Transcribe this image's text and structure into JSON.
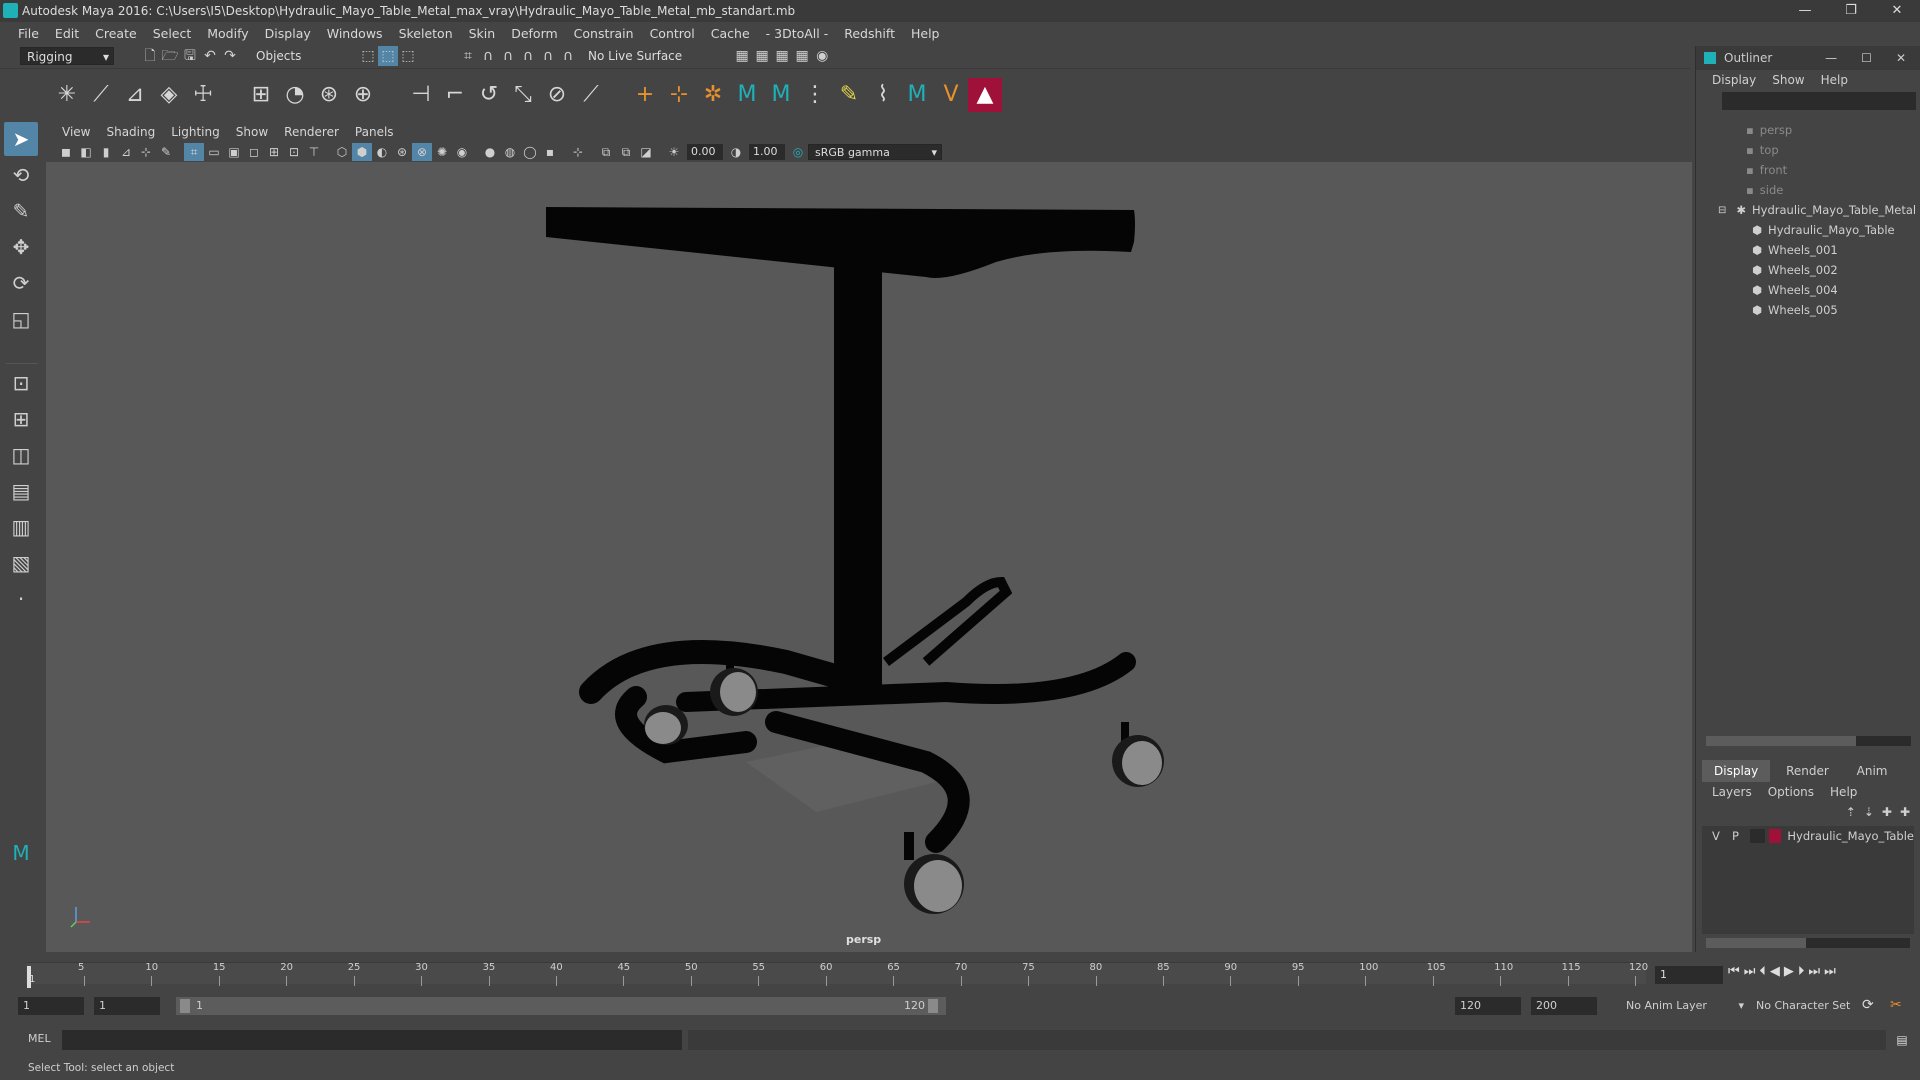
{
  "window": {
    "title": "Autodesk Maya 2016: C:\\Users\\I5\\Desktop\\Hydraulic_Mayo_Table_Metal_max_vray\\Hydraulic_Mayo_Table_Metal_mb_standart.mb",
    "minimize": "—",
    "restore": "❐",
    "close": "✕"
  },
  "menubar": [
    "File",
    "Edit",
    "Create",
    "Select",
    "Modify",
    "Display",
    "Windows",
    "Skeleton",
    "Skin",
    "Deform",
    "Constrain",
    "Control",
    "Cache",
    "- 3DtoAll -",
    "Redshift",
    "Help"
  ],
  "statusline": {
    "mode": "Rigging",
    "select_mode": "Objects",
    "live_surface": "No Live Surface"
  },
  "panel_menu": [
    "View",
    "Shading",
    "Lighting",
    "Show",
    "Renderer",
    "Panels"
  ],
  "panel_toolbar": {
    "exposure": "0.00",
    "gamma": "1.00",
    "color_space": "sRGB gamma"
  },
  "viewport": {
    "camera_label": "persp"
  },
  "outliner": {
    "title": "Outliner",
    "menu": [
      "Display",
      "Show",
      "Help"
    ],
    "items": [
      {
        "label": "persp",
        "indent": 2,
        "dim": true
      },
      {
        "label": "top",
        "indent": 2,
        "dim": true
      },
      {
        "label": "front",
        "indent": 2,
        "dim": true
      },
      {
        "label": "side",
        "indent": 2,
        "dim": true
      },
      {
        "label": "Hydraulic_Mayo_Table_Metal",
        "indent": 1,
        "dim": false
      },
      {
        "label": "Hydraulic_Mayo_Table",
        "indent": 3,
        "dim": false
      },
      {
        "label": "Wheels_001",
        "indent": 3,
        "dim": false
      },
      {
        "label": "Wheels_002",
        "indent": 3,
        "dim": false
      },
      {
        "label": "Wheels_004",
        "indent": 3,
        "dim": false
      },
      {
        "label": "Wheels_005",
        "indent": 3,
        "dim": false
      }
    ]
  },
  "layers": {
    "tabs": [
      "Display",
      "Render",
      "Anim"
    ],
    "menu": [
      "Layers",
      "Options",
      "Help"
    ],
    "row": {
      "v": "V",
      "p": "P",
      "name": "Hydraulic_Mayo_Table",
      "color": "#a0113a"
    }
  },
  "timeline": {
    "ticks": [
      "5",
      "10",
      "15",
      "20",
      "25",
      "30",
      "35",
      "40",
      "45",
      "50",
      "55",
      "60",
      "65",
      "70",
      "75",
      "80",
      "85",
      "90",
      "95",
      "100",
      "105",
      "110",
      "115",
      "120"
    ],
    "first_tick": "1",
    "current_frame": "1"
  },
  "range": {
    "start": "1",
    "playback_start": "1",
    "slider_start": "1",
    "slider_end": "120",
    "playback_end": "120",
    "end": "200",
    "anim_layer": "No Anim Layer",
    "character_set": "No Character Set"
  },
  "cmdline": {
    "label": "MEL"
  },
  "helpline": {
    "text": "Select Tool: select an object"
  },
  "colors": {
    "accent": "#5285a6",
    "layer_color": "#a0113a"
  }
}
